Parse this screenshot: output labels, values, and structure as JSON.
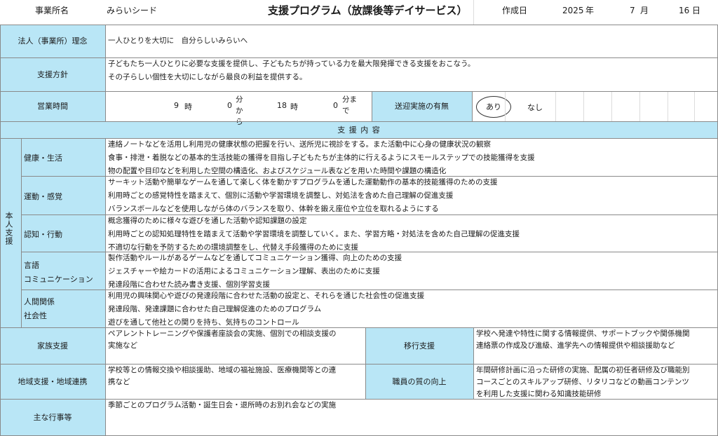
{
  "header": {
    "office_label": "事業所名",
    "office_name": "みらいシード",
    "title": "支援プログラム（放課後等デイサービス）",
    "date_label": "作成日",
    "year": "2025",
    "year_unit": "年",
    "month": "7",
    "month_unit": "月",
    "day": "16",
    "day_unit": "日"
  },
  "philosophy": {
    "label": "法人（事業所）理念",
    "text": "一人ひとりを大切に　自分らしいみらいへ"
  },
  "policy": {
    "label": "支援方針",
    "lines": [
      "子どもたち一人ひとりに必要な支援を提供し、子どもたちが持っている力を最大限発揮できる支援をおこなう。",
      "その子らしい個性を大切にしながら最良の利益を提供する。"
    ]
  },
  "hours": {
    "label": "営業時間",
    "start_hour": "9",
    "hour_unit": "時",
    "start_min": "0",
    "start_min_unit": "分から",
    "end_hour": "18",
    "end_min": "0",
    "end_min_unit": "分まで",
    "transport_label": "送迎実施の有無",
    "transport_yes": "あり",
    "transport_no": "なし"
  },
  "support_header": "支 援 内 容",
  "individual": {
    "label": "本人支援",
    "rows": [
      {
        "label": "健康・生活",
        "lines": [
          "連絡ノートなどを活用し利用児の健康状態の把握を行い、送所児に視診をする。また活動中に心身の健康状況の観察",
          "食事・排泄・着脱などの基本的生活技能の獲得を目指し子どもたちが主体的に行えるようにスモールステップでの技能獲得を支援",
          "物の配置や目印などを利用した空間の構造化、およびスケジュール表などを用いた時間や課題の構造化"
        ]
      },
      {
        "label": "運動・感覚",
        "lines": [
          "サーキット活動や簡単なゲームを通して楽しく体を動かすプログラムを通した運動動作の基本的技能獲得のための支援",
          "利用時ごとの感覚特性を踏まえて、個別に活動や学習環境を調整し、対処法を含めた自己理解の促進支援",
          "バランスボールなどを使用しながら体のバランスを取り、体幹を鍛え座位や立位を取れるようにする"
        ]
      },
      {
        "label": "認知・行動",
        "lines": [
          "概念獲得のために様々な遊びを通した活動や認知課題の設定",
          "利用時ごとの認知処理特性を踏まえて活動や学習環境を調整していく。また、学習方略・対処法を含めた自己理解の促進支援",
          "不適切な行動を予防するための環境調整をし、代替え手段獲得のために支援"
        ]
      },
      {
        "label1": "言語",
        "label2": "コミュニケーション",
        "lines": [
          "製作活動やルールがあるゲームなどを通してコミュニケーション獲得、向上のための支援",
          "ジェスチャーや絵カードの活用によるコミュニケーション理解、表出のために支援",
          "発達段階に合わせた読み書き支援、個別学習支援"
        ]
      },
      {
        "label1": "人間関係",
        "label2": "社会性",
        "lines": [
          "利用児の興味関心や遊びの発達段階に合わせた活動の設定と、それらを通じた社会性の促進支援",
          "発達段階、発達課題に合わせた自己理解促進のためのプログラム",
          "遊びを通して他社との関りを持ち、気持ちのコントロール"
        ]
      }
    ]
  },
  "family": {
    "label": "家族支援",
    "lines": [
      "ペアレントトレーニングや保護者座談会の実施、個別での相談支援の",
      "実施など"
    ]
  },
  "transition": {
    "label": "移行支援",
    "lines": [
      "学校へ発達や特性に関する情報提供、サポートブックや関係機関",
      "連絡票の作成及び進級、進学先への情報提供や相談援助など"
    ]
  },
  "community": {
    "label": "地域支援・地域連携",
    "lines": [
      "学校等との情報交換や相談援助、地域の福祉施設、医療機関等との連",
      "携など"
    ]
  },
  "staff": {
    "label": "職員の質の向上",
    "lines": [
      "年間研修計画に沿った研修の実施、配属の初任者研修及び職能別",
      "コースごとのスキルアップ研修、リタリコなどの動画コンテンツ",
      "を利用した支援に関わる知識技能研修"
    ]
  },
  "events": {
    "label": "主な行事等",
    "text": "季節ごとのプログラム活動・誕生日会・退所時のお別れ会などの実施"
  },
  "colors": {
    "label_bg": "#b9e6f6",
    "border": "#8a8a8a"
  }
}
